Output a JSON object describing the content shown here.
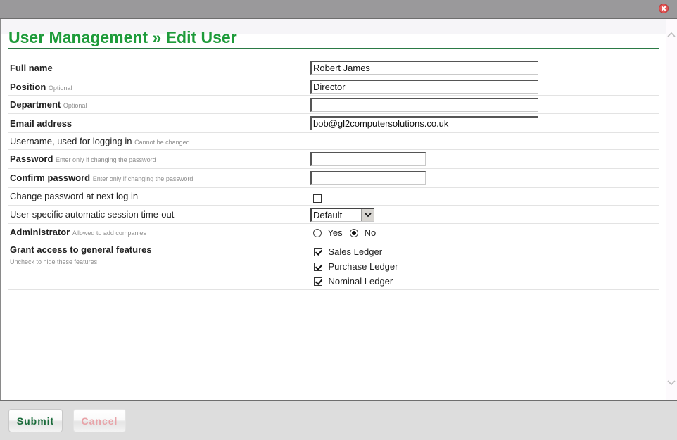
{
  "window": {
    "close_icon": "close-icon"
  },
  "header": {
    "title": "User Management » Edit User"
  },
  "form": {
    "full_name": {
      "label": "Full name",
      "value": "Robert James"
    },
    "position": {
      "label": "Position",
      "hint": "Optional",
      "value": "Director"
    },
    "department": {
      "label": "Department",
      "hint": "Optional",
      "value": ""
    },
    "email": {
      "label": "Email address",
      "value": "bob@gl2computersolutions.co.uk"
    },
    "username": {
      "label": "Username, used for logging in",
      "hint": "Cannot be changed"
    },
    "password": {
      "label": "Password",
      "hint": "Enter only if changing the password",
      "value": ""
    },
    "confirm_password": {
      "label": "Confirm password",
      "hint": "Enter only if changing the password",
      "value": ""
    },
    "change_password": {
      "label": "Change password at next log in",
      "checked": false
    },
    "session_timeout": {
      "label": "User-specific automatic session time-out",
      "selected": "Default"
    },
    "administrator": {
      "label": "Administrator",
      "hint": "Allowed to add companies",
      "options": [
        {
          "label": "Yes",
          "selected": false
        },
        {
          "label": "No",
          "selected": true
        }
      ]
    },
    "features": {
      "label": "Grant access to general features",
      "hint": "Uncheck to hide these features",
      "items": [
        {
          "label": "Sales Ledger",
          "checked": true
        },
        {
          "label": "Purchase Ledger",
          "checked": true
        },
        {
          "label": "Nominal Ledger",
          "checked": true
        }
      ]
    }
  },
  "footer": {
    "submit_label": "Submit",
    "cancel_label": "Cancel"
  },
  "colors": {
    "title_green": "#1e9b3a",
    "submit_text": "#1a6b3a",
    "cancel_text": "#e8a3a8",
    "close_red": "#e25555"
  }
}
